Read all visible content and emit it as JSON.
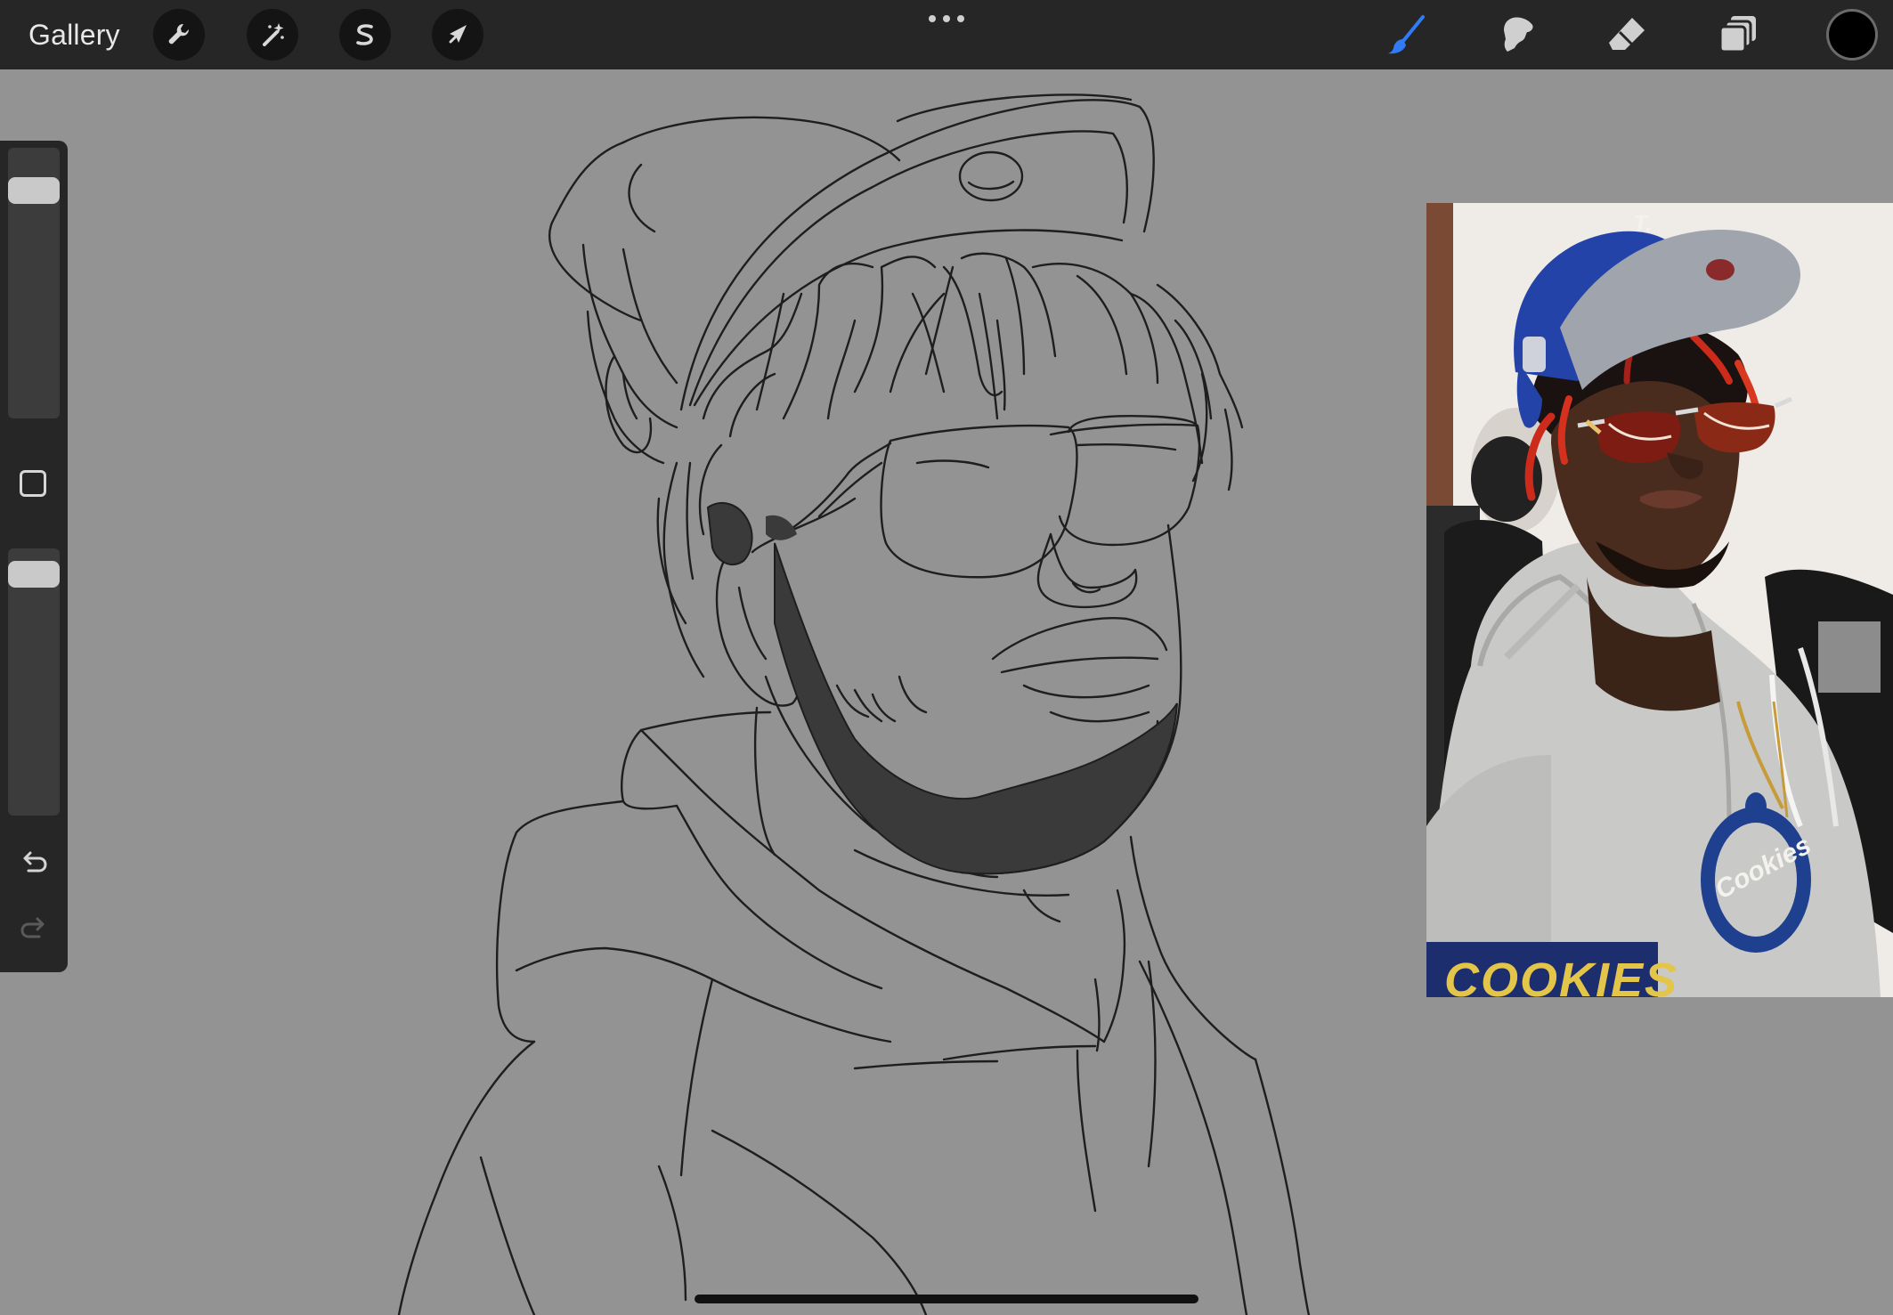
{
  "toolbar": {
    "gallery_label": "Gallery",
    "left_tools": [
      {
        "name": "actions",
        "icon": "wrench-icon"
      },
      {
        "name": "adjustments",
        "icon": "magic-wand-icon"
      },
      {
        "name": "selection",
        "icon": "selection-s-icon"
      },
      {
        "name": "transform",
        "icon": "arrow-cursor-icon"
      }
    ],
    "more_icon": "more-dots-icon",
    "right_tools": [
      {
        "name": "brush",
        "icon": "brush-icon",
        "active": true,
        "color": "#2f7cf6"
      },
      {
        "name": "smudge",
        "icon": "smudge-finger-icon",
        "active": false
      },
      {
        "name": "eraser",
        "icon": "eraser-icon",
        "active": false
      },
      {
        "name": "layers",
        "icon": "layers-icon",
        "active": false
      }
    ],
    "current_color": "#000000"
  },
  "sidebar": {
    "brush_size_level": 0.88,
    "brush_opacity_level": 0.95,
    "modify_button_icon": "square-icon",
    "undo_icon": "undo-arrow-icon",
    "redo_icon": "redo-arrow-icon",
    "redo_enabled": false
  },
  "reference_photo": {
    "visible_text": [
      "T.",
      "Cookies",
      "COOKIES"
    ]
  },
  "canvas": {
    "background": "#939393",
    "fill_color": "#3a3a3a",
    "line_color": "#1e1e1e"
  }
}
